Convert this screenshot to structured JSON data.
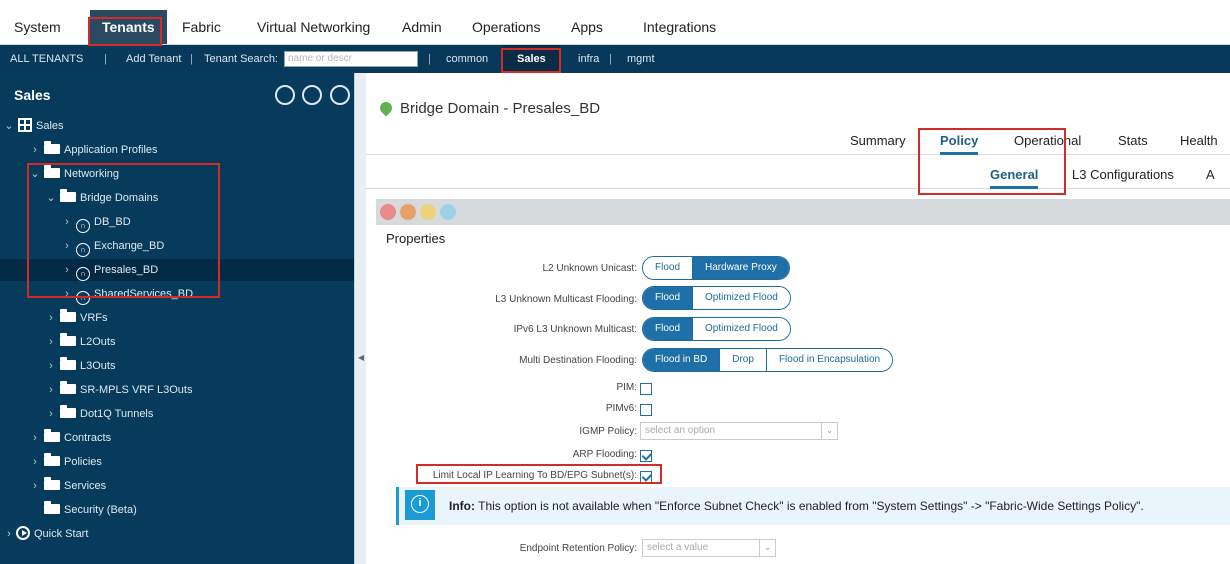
{
  "top_menu": {
    "items": [
      "System",
      "Tenants",
      "Fabric",
      "Virtual Networking",
      "Admin",
      "Operations",
      "Apps",
      "Integrations"
    ],
    "active": "Tenants"
  },
  "sub_bar": {
    "all_tenants": "ALL TENANTS",
    "add_tenant": "Add Tenant",
    "tenant_search_label": "Tenant Search:",
    "search_placeholder": "name or descr",
    "tenants": [
      "common",
      "Sales",
      "infra",
      "mgmt"
    ],
    "active_tenant": "Sales",
    "separator": "|"
  },
  "sidebar": {
    "title": "Sales",
    "tree": {
      "root": "Sales",
      "application_profiles": "Application Profiles",
      "networking": "Networking",
      "bridge_domains": "Bridge Domains",
      "bd_items": [
        "DB_BD",
        "Exchange_BD",
        "Presales_BD",
        "SharedServices_BD"
      ],
      "selected_bd": "Presales_BD",
      "networking_children": [
        "VRFs",
        "L2Outs",
        "L3Outs",
        "SR-MPLS VRF L3Outs",
        "Dot1Q Tunnels"
      ],
      "contracts": "Contracts",
      "policies": "Policies",
      "services": "Services",
      "security": "Security (Beta)",
      "quick_start": "Quick Start"
    }
  },
  "main": {
    "title": "Bridge Domain - Presales_BD",
    "tabs": [
      "Summary",
      "Policy",
      "Operational",
      "Stats",
      "Health"
    ],
    "active_tab": "Policy",
    "subtabs": [
      "General",
      "L3 Configurations",
      "A"
    ],
    "active_subtab": "General",
    "section_title": "Properties",
    "props": {
      "l2_unknown_unicast": {
        "label": "L2 Unknown Unicast:",
        "options": [
          "Flood",
          "Hardware Proxy"
        ],
        "selected": "Hardware Proxy"
      },
      "l3_unknown_multicast": {
        "label": "L3 Unknown Multicast Flooding:",
        "options": [
          "Flood",
          "Optimized Flood"
        ],
        "selected": "Flood"
      },
      "ipv6_l3_unknown_multicast": {
        "label": "IPv6 L3 Unknown Multicast:",
        "options": [
          "Flood",
          "Optimized Flood"
        ],
        "selected": "Flood"
      },
      "multi_destination_flooding": {
        "label": "Multi Destination Flooding:",
        "options": [
          "Flood in BD",
          "Drop",
          "Flood in Encapsulation"
        ],
        "selected": "Flood in BD"
      },
      "pim": {
        "label": "PIM:",
        "checked": false
      },
      "pimv6": {
        "label": "PIMv6:",
        "checked": false
      },
      "igmp_policy": {
        "label": "IGMP Policy:",
        "placeholder": "select an option"
      },
      "arp_flooding": {
        "label": "ARP Flooding:",
        "checked": true
      },
      "limit_local_ip": {
        "label": "Limit Local IP Learning To BD/EPG Subnet(s):",
        "checked": true
      },
      "endpoint_retention": {
        "label": "Endpoint Retention Policy:",
        "placeholder": "select a value"
      }
    },
    "info": {
      "prefix": "Info:",
      "text": "This option is not available when \"Enforce Subnet Check\" is enabled from \"System Settings\" -> \"Fabric-Wide Settings Policy\"."
    }
  },
  "colors": {
    "sidebar_bg": "#073b5c",
    "subbar_bg": "#08395a",
    "accent": "#1f6fa8",
    "highlight": "#d32a2a"
  }
}
